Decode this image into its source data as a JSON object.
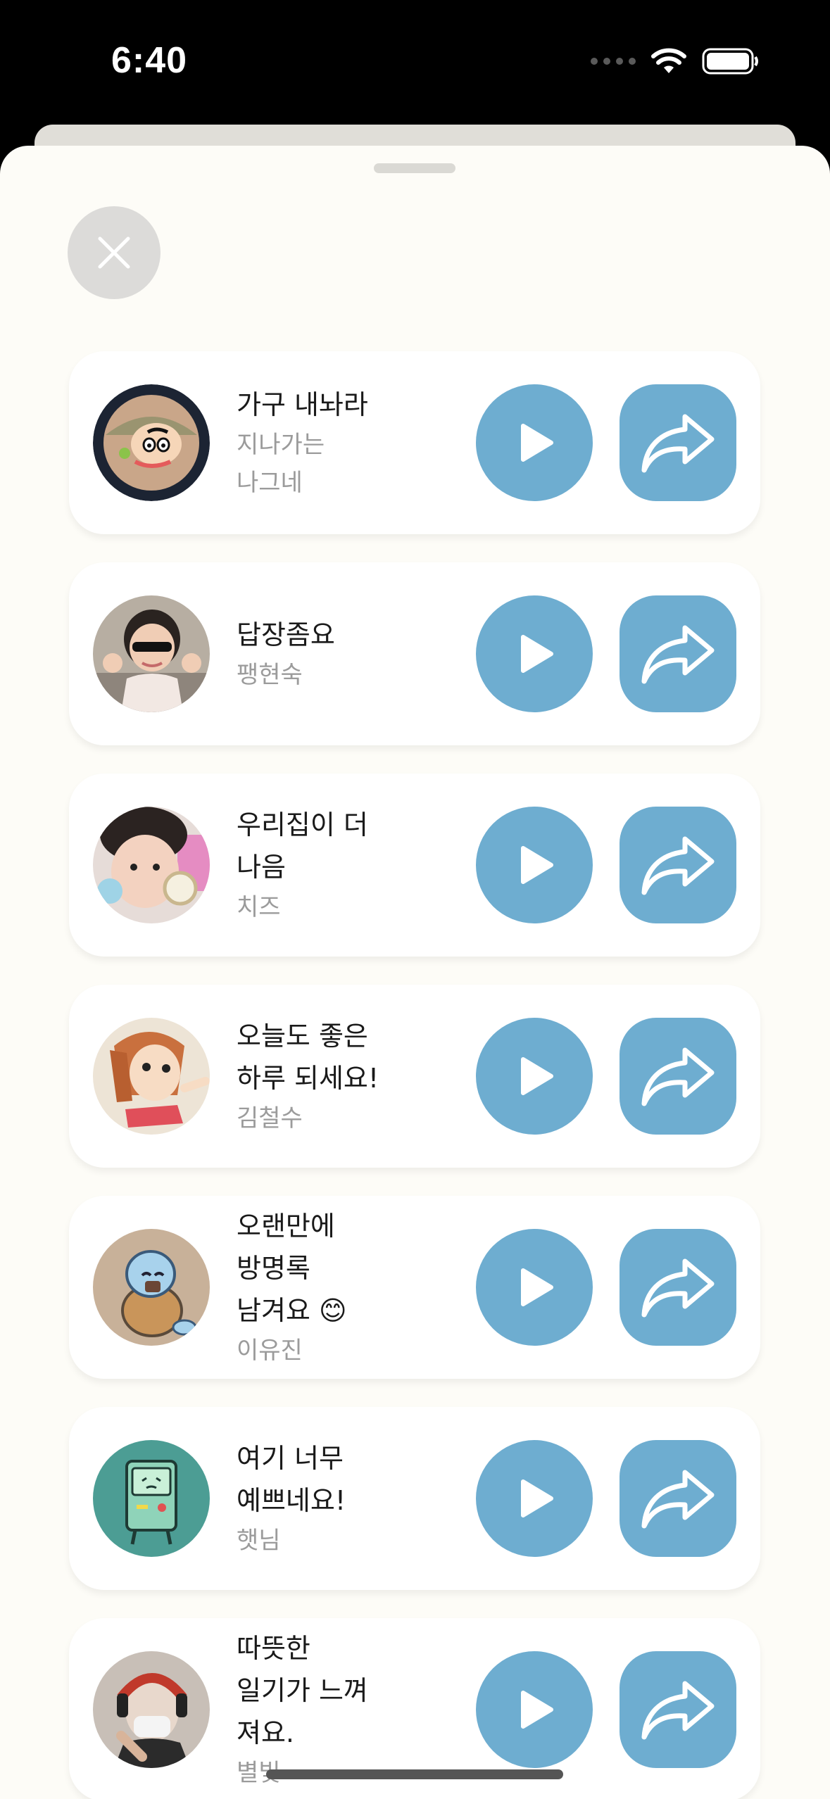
{
  "status_bar": {
    "time": "6:40"
  },
  "colors": {
    "accent": "#6eadd0",
    "sheet_background": "#fdfcf7",
    "card_background": "#ffffff"
  },
  "close_button": {
    "icon": "close-icon"
  },
  "guestbook": [
    {
      "message": "가구 내놔라",
      "author": "지나가는\n나그네",
      "avatar": "shin-chan-avatar"
    },
    {
      "message": "답장좀요",
      "author": "팽현숙",
      "avatar": "baby-sunglasses-avatar"
    },
    {
      "message": "우리집이 더\n나음",
      "author": "치즈",
      "avatar": "child-photo-avatar"
    },
    {
      "message": "오늘도 좋은\n하루 되세요!",
      "author": "김철수",
      "avatar": "cartoon-girl-avatar"
    },
    {
      "message": "오랜만에\n방명록\n남겨요 😊",
      "author": "이유진",
      "avatar": "squirtle-avatar"
    },
    {
      "message": "여기 너무\n예쁘네요!",
      "author": "햇님",
      "avatar": "bmo-avatar"
    },
    {
      "message": "따뜻한\n일기가 느껴\n져요.",
      "author": "별빛",
      "avatar": "headphones-person-avatar"
    }
  ]
}
